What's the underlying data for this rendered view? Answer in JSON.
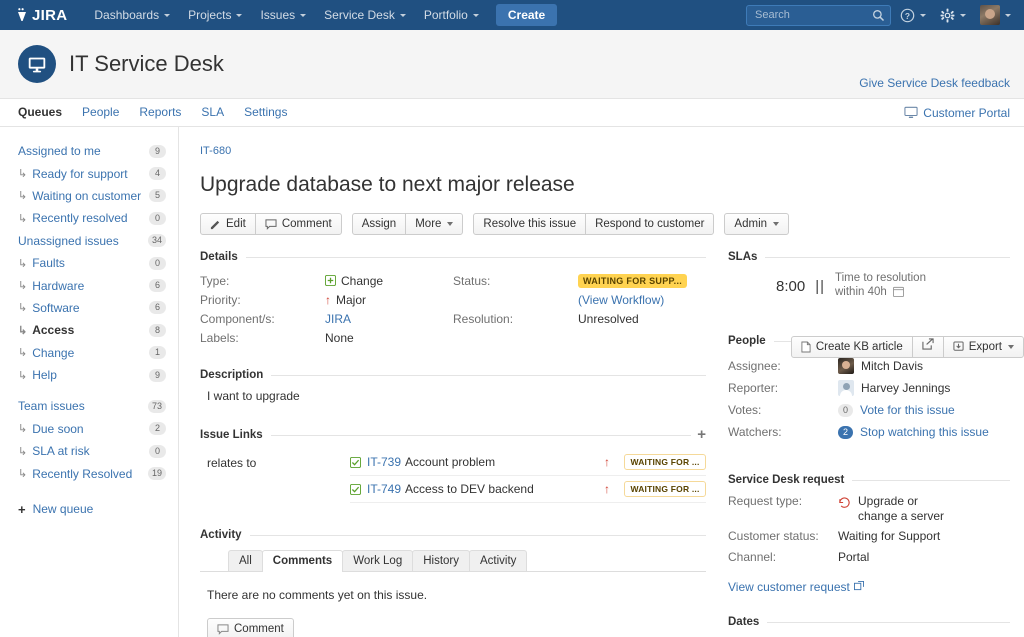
{
  "topnav": {
    "brand": "JIRA",
    "items": [
      {
        "label": "Dashboards",
        "caret": true
      },
      {
        "label": "Projects",
        "caret": true
      },
      {
        "label": "Issues",
        "caret": true
      },
      {
        "label": "Service Desk",
        "caret": true
      },
      {
        "label": "Portfolio",
        "caret": true
      }
    ],
    "create_label": "Create",
    "search_placeholder": "Search",
    "search_value": "",
    "help_icon": "help-icon",
    "settings_icon": "gear-icon",
    "avatar_icon": "user-avatar"
  },
  "project": {
    "title": "IT Service Desk",
    "avatar_icon": "monitor-icon",
    "feedback_link": "Give Service Desk feedback",
    "tabs": [
      {
        "label": "Queues",
        "active": true
      },
      {
        "label": "People",
        "active": false
      },
      {
        "label": "Reports",
        "active": false
      },
      {
        "label": "SLA",
        "active": false
      },
      {
        "label": "Settings",
        "active": false
      }
    ],
    "portal_link": "Customer Portal"
  },
  "sidebar": {
    "queues": [
      {
        "label": "Assigned to me",
        "count": "9",
        "sub": false,
        "active": false
      },
      {
        "label": "Ready for support",
        "count": "4",
        "sub": true,
        "active": false
      },
      {
        "label": "Waiting on customer",
        "count": "5",
        "sub": true,
        "active": false
      },
      {
        "label": "Recently resolved",
        "count": "0",
        "sub": true,
        "active": false
      },
      {
        "label": "Unassigned issues",
        "count": "34",
        "sub": false,
        "active": false
      },
      {
        "label": "Faults",
        "count": "0",
        "sub": true,
        "active": false
      },
      {
        "label": "Hardware",
        "count": "6",
        "sub": true,
        "active": false
      },
      {
        "label": "Software",
        "count": "6",
        "sub": true,
        "active": false
      },
      {
        "label": "Access",
        "count": "8",
        "sub": true,
        "active": true
      },
      {
        "label": "Change",
        "count": "1",
        "sub": true,
        "active": false
      },
      {
        "label": "Help",
        "count": "9",
        "sub": true,
        "active": false
      },
      {
        "label": "Team issues",
        "count": "73",
        "sub": false,
        "active": false
      },
      {
        "label": "Due soon",
        "count": "2",
        "sub": true,
        "active": false
      },
      {
        "label": "SLA at risk",
        "count": "0",
        "sub": true,
        "active": false
      },
      {
        "label": "Recently Resolved",
        "count": "19",
        "sub": true,
        "active": false
      }
    ],
    "new_queue_label": "New queue"
  },
  "issue": {
    "key": "IT-680",
    "title": "Upgrade database to next major release",
    "buttons": {
      "edit": "Edit",
      "comment": "Comment",
      "assign": "Assign",
      "more": "More",
      "resolve": "Resolve this issue",
      "respond": "Respond to customer",
      "admin": "Admin",
      "create_kb": "Create KB article",
      "share_icon": "share-icon",
      "export": "Export"
    }
  },
  "details": {
    "heading": "Details",
    "type_label": "Type:",
    "type_value": "Change",
    "type_icon": "change-icon",
    "priority_label": "Priority:",
    "priority_value": "Major",
    "priority_icon": "priority-major-up-arrow",
    "components_label": "Component/s:",
    "components_value": "JIRA",
    "labels_label": "Labels:",
    "labels_value": "None",
    "status_label": "Status:",
    "status_value": "WAITING FOR SUPP...",
    "status_color": "#ffd351",
    "view_workflow": "(View Workflow)",
    "resolution_label": "Resolution:",
    "resolution_value": "Unresolved"
  },
  "description": {
    "heading": "Description",
    "text": "I want to upgrade"
  },
  "issue_links": {
    "heading": "Issue Links",
    "add_icon": "plus-icon",
    "relation": "relates to",
    "rows": [
      {
        "key": "IT-739",
        "summary": "Account problem",
        "status": "WAITING FOR ...",
        "priority_icon": "priority-up-arrow",
        "check_icon": "checked-icon"
      },
      {
        "key": "IT-749",
        "summary": "Access to DEV backend",
        "status": "WAITING FOR ...",
        "priority_icon": "priority-up-arrow",
        "check_icon": "checked-icon"
      }
    ]
  },
  "activity": {
    "heading": "Activity",
    "tabs": [
      {
        "label": "All",
        "active": false
      },
      {
        "label": "Comments",
        "active": true
      },
      {
        "label": "Work Log",
        "active": false
      },
      {
        "label": "History",
        "active": false
      },
      {
        "label": "Activity",
        "active": false
      }
    ],
    "empty_text": "There are no comments yet on this issue.",
    "comment_button": "Comment"
  },
  "slas": {
    "heading": "SLAs",
    "time": "8:00",
    "paused_icon": "pause-icon",
    "name": "Time to resolution",
    "goal": "within 40h",
    "calendar_icon": "calendar-icon"
  },
  "people": {
    "heading": "People",
    "assignee_label": "Assignee:",
    "assignee_value": "Mitch Davis",
    "reporter_label": "Reporter:",
    "reporter_value": "Harvey Jennings",
    "votes_label": "Votes:",
    "votes_count": "0",
    "votes_link": "Vote for this issue",
    "watchers_label": "Watchers:",
    "watchers_count": "2",
    "watchers_link": "Stop watching this issue"
  },
  "service_desk_request": {
    "heading": "Service Desk request",
    "request_type_label": "Request type:",
    "request_type_value": "Upgrade or change a server",
    "request_type_icon": "server-upgrade-icon",
    "customer_status_label": "Customer status:",
    "customer_status_value": "Waiting for Support",
    "channel_label": "Channel:",
    "channel_value": "Portal",
    "view_request_link": "View customer request",
    "external_icon": "external-link-icon"
  },
  "dates": {
    "heading": "Dates"
  }
}
